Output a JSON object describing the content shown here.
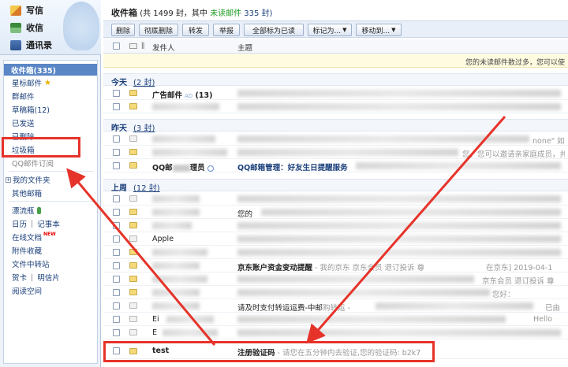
{
  "nav": {
    "write": "写信",
    "receive": "收信",
    "contacts": "通讯录"
  },
  "folders": {
    "inbox": "收件箱(335)",
    "starred": "星标邮件",
    "group": "群邮件",
    "drafts": "草稿箱(12)",
    "sent": "已发送",
    "deleted": "已删除",
    "junk": "垃圾箱",
    "qq_subscribe": "QQ邮件订阅",
    "my_folders": "我的文件夹",
    "other_mailbox": "其他邮箱",
    "drift_bottle": "漂流瓶",
    "calendar": "日历",
    "notes": "记事本",
    "online_docs": "在线文档",
    "new_badge": "NEW",
    "attachments": "附件收藏",
    "file_transfer": "文件中转站",
    "cards": "贺卡",
    "postcards": "明信片",
    "reading_space": "阅读空间"
  },
  "header": {
    "title": "收件箱",
    "count_prefix": "(共 1499 封，其中",
    "unread_label": "未读邮件",
    "unread_count": "335 封)"
  },
  "toolbar": {
    "delete": "删除",
    "perm_delete": "彻底删除",
    "forward": "转发",
    "report": "举报",
    "mark_all_read": "全部标为已读",
    "mark_as": "标记为...",
    "move_to": "移动到..."
  },
  "columns": {
    "sender": "发件人",
    "subject": "主题"
  },
  "notice": "您的未读邮件数过多，您可以使",
  "groups": {
    "today": {
      "label": "今天",
      "count": "(2 封)"
    },
    "yesterday": {
      "label": "昨天",
      "count": "(3 封)"
    },
    "lastweek": {
      "label": "上周",
      "count": "(12 封)"
    }
  },
  "rows": {
    "ad_sender": "广告邮件",
    "ad_tag": "AD",
    "ad_count": "(13)",
    "y_qq_sender": "QQ邮",
    "y_qq_sender2": "理员",
    "y_qq_subject": "QQ邮箱管理：好友生日提醒服务 -",
    "y1_subject_tail": "none\" 如",
    "y2_subject_tail": "您，您可以邀请亲家庭成员，并且可",
    "lw_apple": "Apple",
    "lw_yours": "您的",
    "lw_jd_subject": "京东账户资金变动提醒",
    "lw_jd_preview": "- 我的京东 京东会员 退订投诉 尊",
    "lw_jd_right": "在京东] 2019-04-1",
    "lw_jd_right2": "京东会员 退订投诉 尊",
    "lw_pay": "请及时支付转运运费-中邮",
    "lw_pay_tail": "购转运 -",
    "lw_pay_right": "已由",
    "lw_hello": "您好：",
    "lw_hello2": "Hello",
    "lw_sender_e": "Ei",
    "lw_sender_e2": "E",
    "test_sender": "test",
    "test_subject": "注册验证码",
    "test_preview": "- 请您在五分钟内去验证,您的验证码: b2k7"
  }
}
